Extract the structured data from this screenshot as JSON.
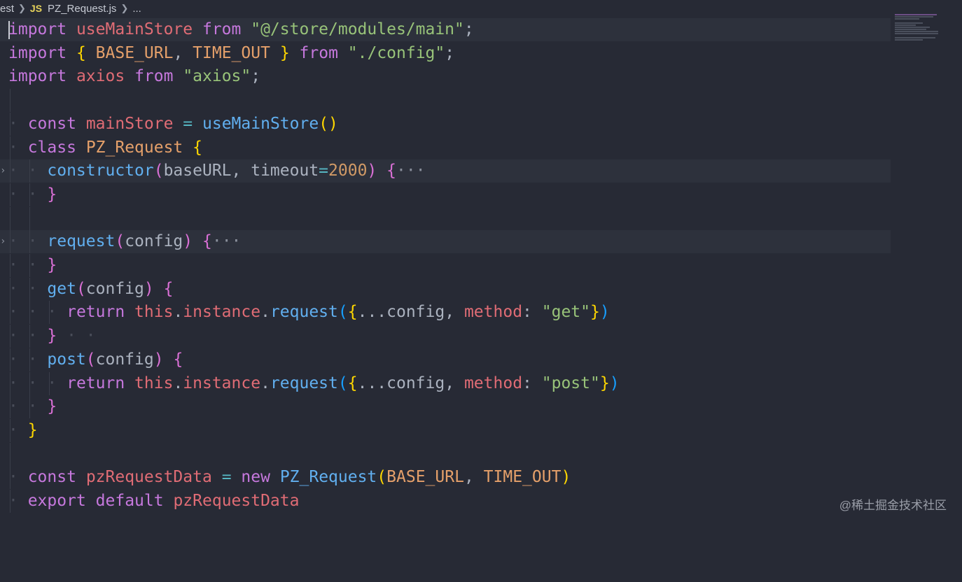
{
  "breadcrumb": {
    "folder": "est",
    "lang_badge": "JS",
    "file": "PZ_Request.js",
    "more": "..."
  },
  "code": {
    "l1": {
      "kw1": "import",
      "name": "useMainStore",
      "kw2": "from",
      "src": "\"@/store/modules/main\"",
      "semi": ";"
    },
    "l2": {
      "kw1": "import",
      "open": "{",
      "a": "BASE_URL",
      "comma": ",",
      "b": "TIME_OUT",
      "close": "}",
      "kw2": "from",
      "src": "\"./config\"",
      "semi": ";"
    },
    "l3": {
      "kw1": "import",
      "name": "axios",
      "kw2": "from",
      "src": "\"axios\"",
      "semi": ";"
    },
    "l5": {
      "kw": "const",
      "name": "mainStore",
      "eq": "=",
      "fn": "useMainStore",
      "parens": "()"
    },
    "l6": {
      "kw": "class",
      "name": "PZ_Request",
      "open": "{"
    },
    "l7": {
      "fn": "constructor",
      "p1": "(",
      "a1": "baseURL",
      "comma": ",",
      "a2": "timeout",
      "eq": "=",
      "num": "2000",
      "p2": ")",
      "open": "{",
      "ell": "···"
    },
    "l8": {
      "close": "}"
    },
    "l10": {
      "fn": "request",
      "p1": "(",
      "a1": "config",
      "p2": ")",
      "open": "{",
      "ell": "···"
    },
    "l11": {
      "close": "}"
    },
    "l12": {
      "fn": "get",
      "p1": "(",
      "a1": "config",
      "p2": ")",
      "open": "{"
    },
    "l13": {
      "kw": "return",
      "this": "this",
      "d1": ".",
      "inst": "instance",
      "d2": ".",
      "fn": "request",
      "p1": "(",
      "o": "{",
      "spread": "...",
      "cfg": "config",
      "comma": ",",
      "key": "method",
      "colon": ":",
      "val": "\"get\"",
      "c": "}",
      "p2": ")"
    },
    "l14": {
      "close": "}"
    },
    "l15": {
      "fn": "post",
      "p1": "(",
      "a1": "config",
      "p2": ")",
      "open": "{"
    },
    "l16": {
      "kw": "return",
      "this": "this",
      "d1": ".",
      "inst": "instance",
      "d2": ".",
      "fn": "request",
      "p1": "(",
      "o": "{",
      "spread": "...",
      "cfg": "config",
      "comma": ",",
      "key": "method",
      "colon": ":",
      "val": "\"post\"",
      "c": "}",
      "p2": ")"
    },
    "l17": {
      "close": "}"
    },
    "l18": {
      "close": "}"
    },
    "l20": {
      "kw1": "const",
      "name": "pzRequestData",
      "eq": "=",
      "kw2": "new",
      "cls": "PZ_Request",
      "p1": "(",
      "a": "BASE_URL",
      "comma": ",",
      "b": "TIME_OUT",
      "p2": ")"
    },
    "l21": {
      "kw1": "export",
      "kw2": "default",
      "name": "pzRequestData"
    }
  },
  "watermark": "@稀土掘金技术社区"
}
